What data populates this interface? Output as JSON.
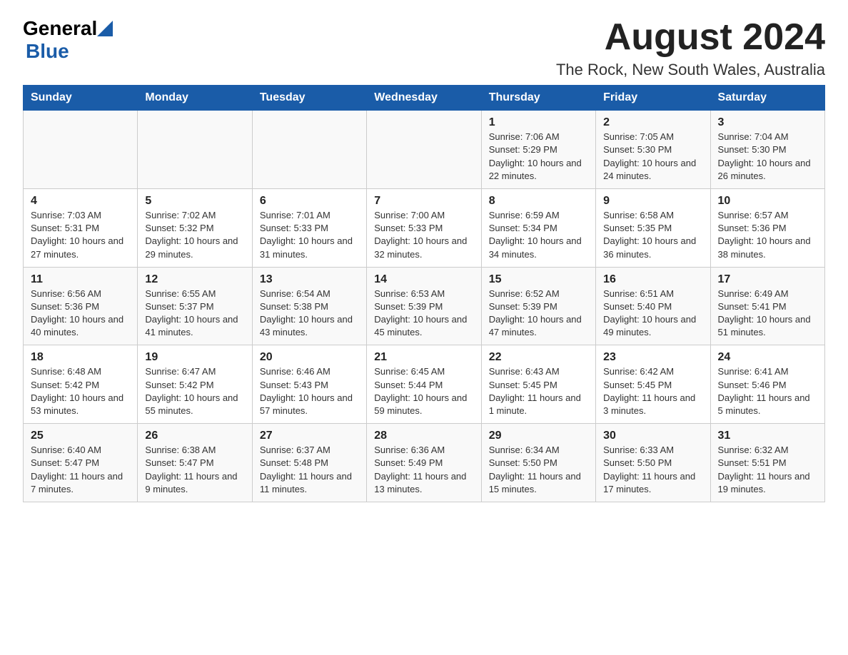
{
  "logo": {
    "general": "General",
    "blue": "Blue"
  },
  "header": {
    "title": "August 2024",
    "subtitle": "The Rock, New South Wales, Australia"
  },
  "weekdays": [
    "Sunday",
    "Monday",
    "Tuesday",
    "Wednesday",
    "Thursday",
    "Friday",
    "Saturday"
  ],
  "weeks": [
    [
      {
        "day": "",
        "info": ""
      },
      {
        "day": "",
        "info": ""
      },
      {
        "day": "",
        "info": ""
      },
      {
        "day": "",
        "info": ""
      },
      {
        "day": "1",
        "info": "Sunrise: 7:06 AM\nSunset: 5:29 PM\nDaylight: 10 hours and 22 minutes."
      },
      {
        "day": "2",
        "info": "Sunrise: 7:05 AM\nSunset: 5:30 PM\nDaylight: 10 hours and 24 minutes."
      },
      {
        "day": "3",
        "info": "Sunrise: 7:04 AM\nSunset: 5:30 PM\nDaylight: 10 hours and 26 minutes."
      }
    ],
    [
      {
        "day": "4",
        "info": "Sunrise: 7:03 AM\nSunset: 5:31 PM\nDaylight: 10 hours and 27 minutes."
      },
      {
        "day": "5",
        "info": "Sunrise: 7:02 AM\nSunset: 5:32 PM\nDaylight: 10 hours and 29 minutes."
      },
      {
        "day": "6",
        "info": "Sunrise: 7:01 AM\nSunset: 5:33 PM\nDaylight: 10 hours and 31 minutes."
      },
      {
        "day": "7",
        "info": "Sunrise: 7:00 AM\nSunset: 5:33 PM\nDaylight: 10 hours and 32 minutes."
      },
      {
        "day": "8",
        "info": "Sunrise: 6:59 AM\nSunset: 5:34 PM\nDaylight: 10 hours and 34 minutes."
      },
      {
        "day": "9",
        "info": "Sunrise: 6:58 AM\nSunset: 5:35 PM\nDaylight: 10 hours and 36 minutes."
      },
      {
        "day": "10",
        "info": "Sunrise: 6:57 AM\nSunset: 5:36 PM\nDaylight: 10 hours and 38 minutes."
      }
    ],
    [
      {
        "day": "11",
        "info": "Sunrise: 6:56 AM\nSunset: 5:36 PM\nDaylight: 10 hours and 40 minutes."
      },
      {
        "day": "12",
        "info": "Sunrise: 6:55 AM\nSunset: 5:37 PM\nDaylight: 10 hours and 41 minutes."
      },
      {
        "day": "13",
        "info": "Sunrise: 6:54 AM\nSunset: 5:38 PM\nDaylight: 10 hours and 43 minutes."
      },
      {
        "day": "14",
        "info": "Sunrise: 6:53 AM\nSunset: 5:39 PM\nDaylight: 10 hours and 45 minutes."
      },
      {
        "day": "15",
        "info": "Sunrise: 6:52 AM\nSunset: 5:39 PM\nDaylight: 10 hours and 47 minutes."
      },
      {
        "day": "16",
        "info": "Sunrise: 6:51 AM\nSunset: 5:40 PM\nDaylight: 10 hours and 49 minutes."
      },
      {
        "day": "17",
        "info": "Sunrise: 6:49 AM\nSunset: 5:41 PM\nDaylight: 10 hours and 51 minutes."
      }
    ],
    [
      {
        "day": "18",
        "info": "Sunrise: 6:48 AM\nSunset: 5:42 PM\nDaylight: 10 hours and 53 minutes."
      },
      {
        "day": "19",
        "info": "Sunrise: 6:47 AM\nSunset: 5:42 PM\nDaylight: 10 hours and 55 minutes."
      },
      {
        "day": "20",
        "info": "Sunrise: 6:46 AM\nSunset: 5:43 PM\nDaylight: 10 hours and 57 minutes."
      },
      {
        "day": "21",
        "info": "Sunrise: 6:45 AM\nSunset: 5:44 PM\nDaylight: 10 hours and 59 minutes."
      },
      {
        "day": "22",
        "info": "Sunrise: 6:43 AM\nSunset: 5:45 PM\nDaylight: 11 hours and 1 minute."
      },
      {
        "day": "23",
        "info": "Sunrise: 6:42 AM\nSunset: 5:45 PM\nDaylight: 11 hours and 3 minutes."
      },
      {
        "day": "24",
        "info": "Sunrise: 6:41 AM\nSunset: 5:46 PM\nDaylight: 11 hours and 5 minutes."
      }
    ],
    [
      {
        "day": "25",
        "info": "Sunrise: 6:40 AM\nSunset: 5:47 PM\nDaylight: 11 hours and 7 minutes."
      },
      {
        "day": "26",
        "info": "Sunrise: 6:38 AM\nSunset: 5:47 PM\nDaylight: 11 hours and 9 minutes."
      },
      {
        "day": "27",
        "info": "Sunrise: 6:37 AM\nSunset: 5:48 PM\nDaylight: 11 hours and 11 minutes."
      },
      {
        "day": "28",
        "info": "Sunrise: 6:36 AM\nSunset: 5:49 PM\nDaylight: 11 hours and 13 minutes."
      },
      {
        "day": "29",
        "info": "Sunrise: 6:34 AM\nSunset: 5:50 PM\nDaylight: 11 hours and 15 minutes."
      },
      {
        "day": "30",
        "info": "Sunrise: 6:33 AM\nSunset: 5:50 PM\nDaylight: 11 hours and 17 minutes."
      },
      {
        "day": "31",
        "info": "Sunrise: 6:32 AM\nSunset: 5:51 PM\nDaylight: 11 hours and 19 minutes."
      }
    ]
  ]
}
